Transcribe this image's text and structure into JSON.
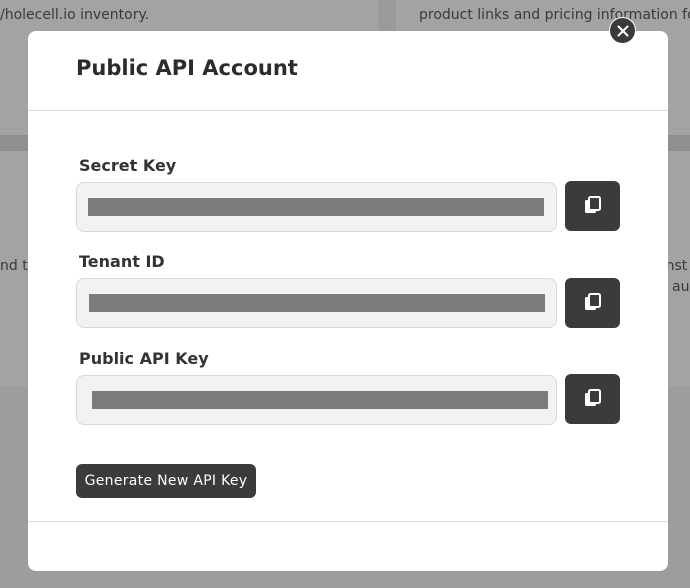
{
  "background": {
    "text_top_left": "/holecell.io inventory.",
    "text_top_right": "product links and pricing information fo",
    "text_mid_left": "nd t",
    "text_mid_right_1": "onst",
    "text_mid_right_2": "au"
  },
  "modal": {
    "title": "Public API Account",
    "fields": [
      {
        "label": "Secret Key"
      },
      {
        "label": "Tenant ID"
      },
      {
        "label": "Public API Key"
      }
    ],
    "generate_label": "Generate New API Key"
  },
  "icons": {
    "close": "close-icon",
    "copy": "copy-icon"
  },
  "colors": {
    "button_dark": "#3b3b3b",
    "input_bg": "#f2f2f2",
    "masked_value": "#7c7c7c",
    "overlay": "#9a9a9a"
  }
}
